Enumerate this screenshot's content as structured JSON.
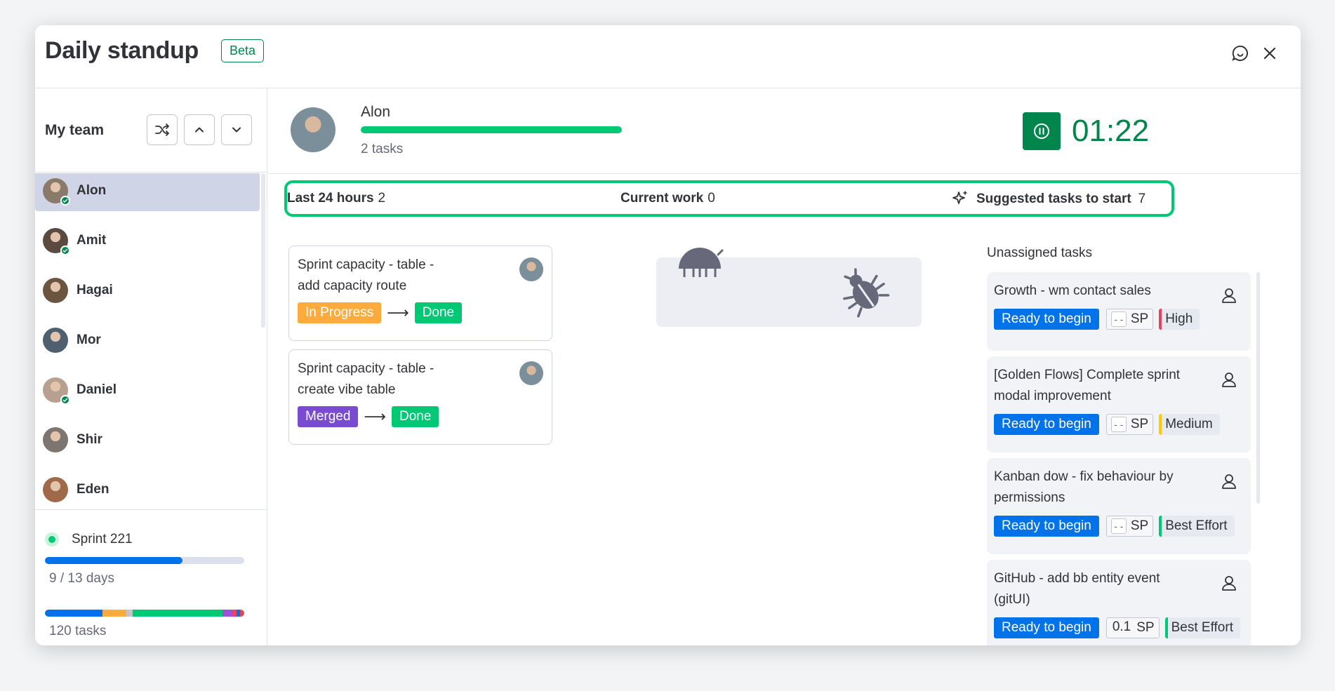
{
  "header": {
    "title": "Daily standup",
    "beta_label": "Beta"
  },
  "sidebar": {
    "team_label": "My team",
    "members": [
      {
        "name": "Alon",
        "color": "#8a7a6a",
        "checked": true,
        "active": true
      },
      {
        "name": "Amit",
        "color": "#5a4a40",
        "checked": true,
        "active": false
      },
      {
        "name": "Hagai",
        "color": "#6b5540",
        "checked": false,
        "active": false
      },
      {
        "name": "Mor",
        "color": "#4e6070",
        "checked": false,
        "active": false
      },
      {
        "name": "Daniel",
        "color": "#b8a090",
        "checked": true,
        "active": false
      },
      {
        "name": "Shir",
        "color": "#7d7570",
        "checked": false,
        "active": false
      },
      {
        "name": "Eden",
        "color": "#a06a4a",
        "checked": false,
        "active": false
      }
    ],
    "sprint": {
      "name": "Sprint 221",
      "days_label": "9 / 13 days",
      "progress": 0.69,
      "tasks_label": "120 tasks",
      "tasks_breakdown": [
        {
          "color": "#0073ea",
          "share": 0.29
        },
        {
          "color": "#fdab3d",
          "share": 0.12
        },
        {
          "color": "#c4c4c4",
          "share": 0.03
        },
        {
          "color": "#00c875",
          "share": 0.45
        },
        {
          "color": "#9d50dd",
          "share": 0.05
        },
        {
          "color": "#ff3d57",
          "share": 0.02
        },
        {
          "color": "#0073ea",
          "share": 0.02
        },
        {
          "color": "#e2445c",
          "share": 0.02
        }
      ]
    }
  },
  "person": {
    "name": "Alon",
    "tasks_label": "2 tasks",
    "progress": 1.0,
    "timer": "01:22"
  },
  "columns": {
    "last24": {
      "label": "Last 24 hours",
      "count": "2"
    },
    "current": {
      "label": "Current work",
      "count": "0"
    },
    "suggested": {
      "label": "Suggested tasks to start",
      "count": "7"
    }
  },
  "last24_cards": [
    {
      "title": "Sprint capacity - table - add capacity route",
      "from": "In Progress",
      "from_color": "#fdab3d",
      "to": "Done",
      "to_color": "#00c875"
    },
    {
      "title": "Sprint capacity - table - create vibe table",
      "from": "Merged",
      "from_color": "#784bd1",
      "to": "Done",
      "to_color": "#00c875"
    }
  ],
  "suggested": {
    "group_label": "Unassigned tasks",
    "items": [
      {
        "title": "Growth - wm contact sales",
        "status": "Ready to begin",
        "sp_value": "- -",
        "sp_unit": "SP",
        "priority": "High",
        "priority_color": "#e2445c"
      },
      {
        "title": "[Golden Flows] Complete sprint modal improvement",
        "status": "Ready to begin",
        "sp_value": "- -",
        "sp_unit": "SP",
        "priority": "Medium",
        "priority_color": "#ffcb00"
      },
      {
        "title": "Kanban dow - fix behaviour by permissions",
        "status": "Ready to begin",
        "sp_value": "- -",
        "sp_unit": "SP",
        "priority": "Best Effort",
        "priority_color": "#00c875"
      },
      {
        "title": "GitHub - add bb entity event (gitUI)",
        "status": "Ready to begin",
        "sp_value": "0.1",
        "sp_unit": "SP",
        "priority": "Best Effort",
        "priority_color": "#00c875"
      }
    ]
  }
}
